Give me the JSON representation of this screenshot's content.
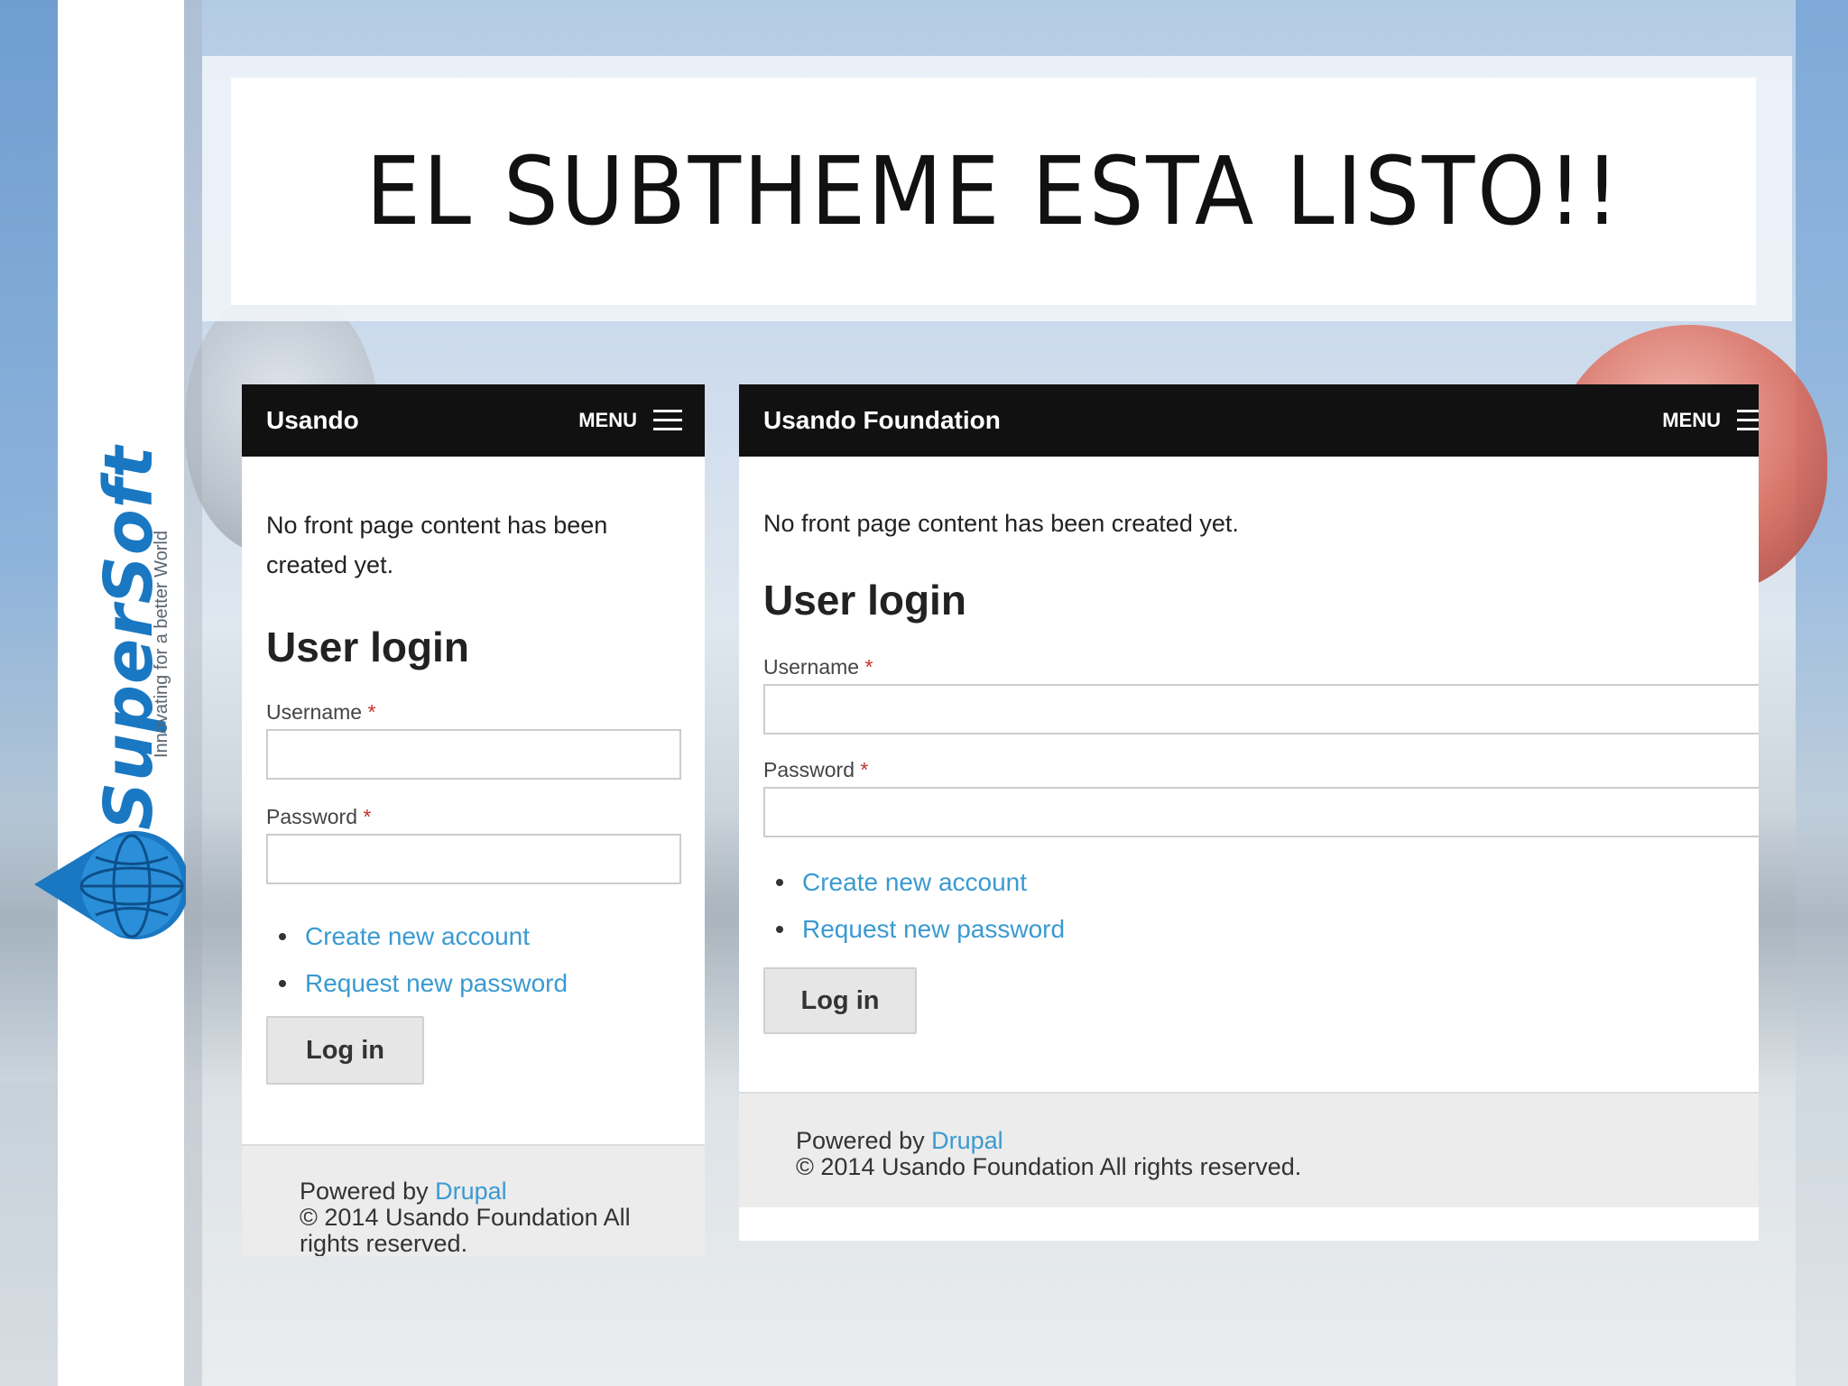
{
  "slide": {
    "title": "EL SUBTHEME ESTA LISTO!!"
  },
  "logo": {
    "name_part1": "Super",
    "name_part2": "Soft",
    "tagline": "Innovating for a better World",
    "colors": {
      "blue": "#1a78c2",
      "orange": "#f07d1e"
    }
  },
  "screen_small": {
    "brand": "Usando",
    "menu_label": "MENU",
    "lead": "No front page content has been created yet.",
    "login_heading": "User login",
    "username_label": "Username",
    "password_label": "Password",
    "required_marker": "*",
    "links": [
      "Create new account",
      "Request new password"
    ],
    "login_button": "Log in",
    "footer_powered": "Powered by",
    "footer_link": "Drupal",
    "footer_copyright": "© 2014 Usando Foundation All rights reserved."
  },
  "screen_large": {
    "brand": "Usando Foundation",
    "menu_label": "MENU",
    "lead": "No front page content has been created yet.",
    "login_heading": "User login",
    "username_label": "Username",
    "password_label": "Password",
    "required_marker": "*",
    "links": [
      "Create new account",
      "Request new password"
    ],
    "login_button": "Log in",
    "footer_powered": "Powered by",
    "footer_link": "Drupal",
    "footer_copyright": "© 2014 Usando Foundation All rights reserved."
  },
  "icons": {
    "menu": "hamburger-icon",
    "logo": "globe-drop-icon"
  },
  "colors": {
    "topbar": "#111111",
    "link": "#3a9ad1",
    "required": "#c4332c",
    "button_bg": "#e6e6e6",
    "footer_bg": "#ececec"
  }
}
